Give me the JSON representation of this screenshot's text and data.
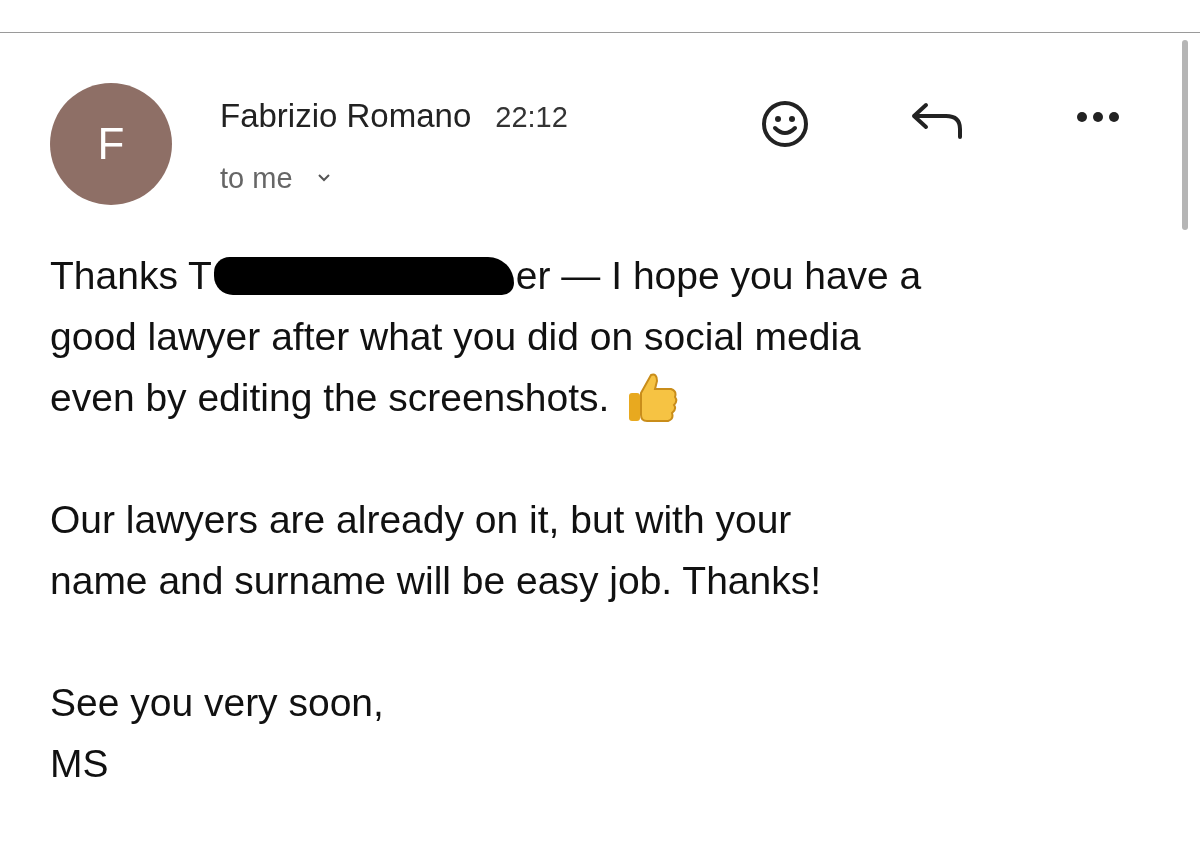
{
  "header": {
    "avatar_letter": "F",
    "sender": "Fabrizio Romano",
    "time": "22:12",
    "recipient": "to me"
  },
  "body": [
    {
      "kind": "redacted",
      "before": "Thanks T",
      "after": "er — I hope you have a",
      "lines": [
        "good lawyer after what you did on social media",
        "even by editing the screenshots."
      ]
    },
    {
      "kind": "plain",
      "lines": [
        "Our lawyers are already on it, but with your",
        "name and surname will be easy job. Thanks!"
      ]
    },
    {
      "kind": "closing",
      "lines": [
        "See you very soon,",
        "MS"
      ]
    }
  ]
}
